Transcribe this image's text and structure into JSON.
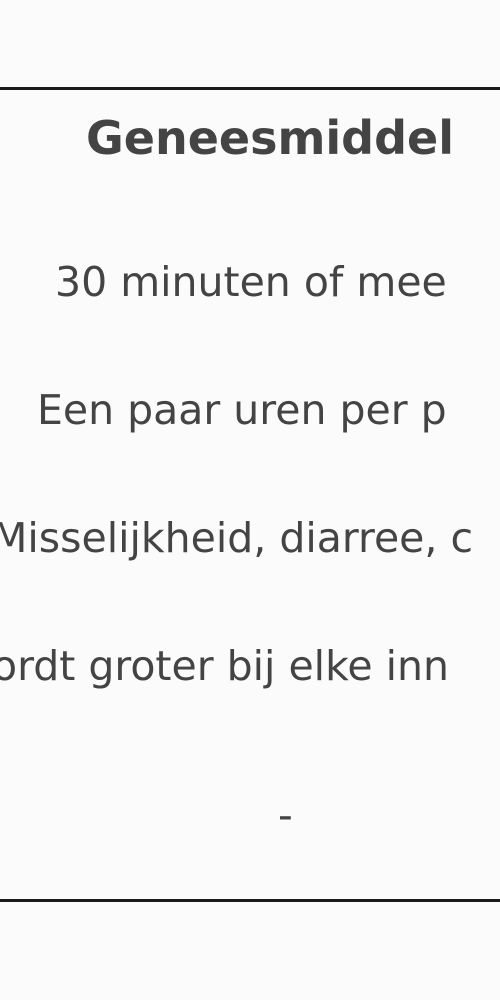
{
  "card": {
    "title": "Geneesmiddel",
    "rows": [
      "30 minuten of mee",
      "Een paar uren per p",
      "Misselijkheid, diarree, c",
      "ordt groter bij elke inn",
      "-"
    ]
  }
}
